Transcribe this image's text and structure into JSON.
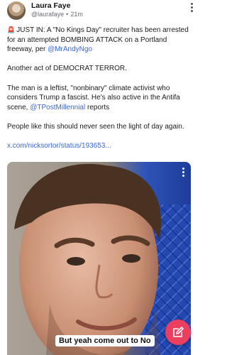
{
  "post": {
    "author_name": "Laura Faye",
    "author_handle": "@laurafaye",
    "separator": "•",
    "age": "21m",
    "siren_icon": "🚨",
    "p1_a": "JUST IN: A \"No Kings Day\" recruiter has been arrested for an attempted BOMBING ATTACK on a Portland freeway, per ",
    "p1_mention": "@MrAndyNgo",
    "p2": "Another act of DEMOCRAT TERROR.",
    "p3_a": "The man is a leftist, \"nonbinary\" climate activist who considers Trump a fascist. He's also active in the Antifa scene, ",
    "p3_mention": "@TPostMillennial",
    "p3_b": " reports",
    "p4": "People like this should never seen the light of day again.",
    "link": "x.com/nicksortor/status/193653..."
  },
  "video": {
    "caption": "But yeah come out to No"
  },
  "icons": {
    "more": "more-vertical-icon",
    "compose": "edit-icon"
  },
  "colors": {
    "link": "#3a67d8",
    "fab": "#ec3e5e",
    "siren": "#d3302f"
  }
}
